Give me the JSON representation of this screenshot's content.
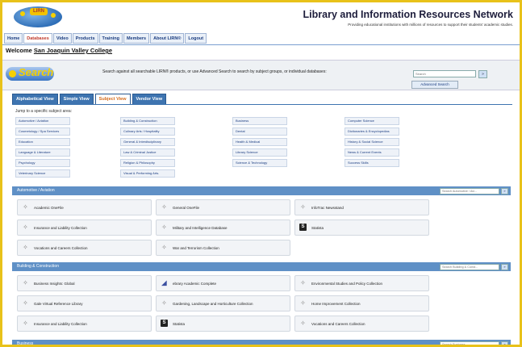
{
  "header": {
    "logo_text": "LIRN",
    "site_title": "Library and Information Resources Network",
    "site_subtitle": "Providing educational institutions with millions of resources to support their students' academic studies."
  },
  "nav": [
    "Home",
    "Databases",
    "Video",
    "Products",
    "Training",
    "Members",
    "About LIRN®",
    "Logout"
  ],
  "nav_active": "Databases",
  "welcome": {
    "prefix": "Welcome",
    "college": "San Joaquin Valley College"
  },
  "search": {
    "logo_text": "Search",
    "description": "Search against all searchable LIRN® products, or use Advanced Search to search by subject groups, or individual databases:",
    "placeholder": "Search",
    "go_label": "»",
    "advanced_label": "Advanced Search"
  },
  "tabs": [
    "Alphabetical View",
    "Simple View",
    "Subject View",
    "Vendor View"
  ],
  "active_tab": "Subject View",
  "jump_label": "Jump to a specific subject area:",
  "subjects": [
    [
      "Automotive / Aviation",
      "Building & Construction",
      "Business",
      "Computer Science"
    ],
    [
      "Cosmetology / Spa Services",
      "Culinary Arts / Hospitality",
      "Dental",
      "Dictionaries & Encyclopedias"
    ],
    [
      "Education",
      "General & Interdisciplinary",
      "Health & Medical",
      "History & Social Science"
    ],
    [
      "Language & Literature",
      "Law & Criminal Justice",
      "Library Science",
      "News & Current Events"
    ],
    [
      "Psychology",
      "Religion & Philosophy",
      "Science & Technology",
      "Success Skills"
    ],
    [
      "Veterinary Science",
      "Visual & Performing Arts."
    ]
  ],
  "sections": [
    {
      "title": "Automotive / Aviation",
      "search_placeholder": "Search Automotive / Avi...",
      "items": [
        {
          "label": "Academic OneFile",
          "icon": "gale-star-icon"
        },
        {
          "label": "General OneFile",
          "icon": "gale-star-icon"
        },
        {
          "label": "InfoTrac Newsstand",
          "icon": "gale-star-icon"
        },
        {
          "label": "Insurance and Liability Collection",
          "icon": "gale-star-icon"
        },
        {
          "label": "Military and Intelligence Database",
          "icon": "gale-star-icon"
        },
        {
          "label": "Statista",
          "icon": "statista-icon"
        },
        {
          "label": "Vocations and Careers Collection",
          "icon": "gale-star-icon"
        },
        {
          "label": "War and Terrorism Collection",
          "icon": "gale-star-icon"
        }
      ]
    },
    {
      "title": "Building & Construction",
      "search_placeholder": "Search Building & Const...",
      "items": [
        {
          "label": "Business Insights: Global",
          "icon": "gale-star-icon"
        },
        {
          "label": "ebrary Academic Complete",
          "icon": "ebrary-icon"
        },
        {
          "label": "Environmental Studies and Policy Collection",
          "icon": "gale-star-icon"
        },
        {
          "label": "Gale Virtual Reference Library",
          "icon": "gale-star-icon"
        },
        {
          "label": "Gardening, Landscape and Horticulture Collection",
          "icon": "gale-star-icon"
        },
        {
          "label": "Home Improvement Collection",
          "icon": "gale-star-icon"
        },
        {
          "label": "Insurance and Liability Collection",
          "icon": "gale-star-icon"
        },
        {
          "label": "Statista",
          "icon": "statista-icon"
        },
        {
          "label": "Vocations and Careers Collection",
          "icon": "gale-star-icon"
        }
      ]
    },
    {
      "title": "Business",
      "search_placeholder": "Search Business...",
      "items": []
    }
  ]
}
